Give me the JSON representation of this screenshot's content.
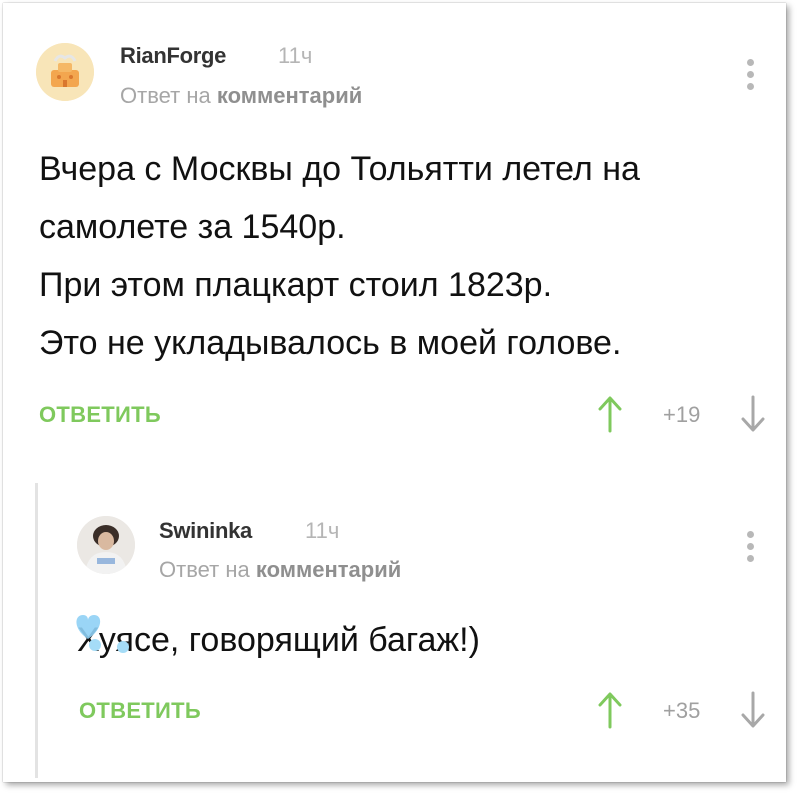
{
  "comments": [
    {
      "username": "RianForge",
      "time": "11ч",
      "reply_prefix": "Ответ на",
      "reply_target": "комментарий",
      "lines": [
        "Вчера с Москвы до Тольятти летел на",
        "самолете за 1540р.",
        "При этом плацкарт стоил 1823р.",
        "Это не укладывалось в моей голове."
      ],
      "reply_label": "ОТВЕТИТЬ",
      "rating": "+19"
    },
    {
      "username": "Swininka",
      "time": "11ч",
      "reply_prefix": "Ответ на",
      "reply_target": "комментарий",
      "lines": [
        "Хуясе, говорящий багаж!)"
      ],
      "reply_label": "ОТВЕТИТЬ",
      "rating": "+35"
    }
  ],
  "colors": {
    "accent_green": "#7fc95d",
    "text": "#111111",
    "muted": "#a6a6a6"
  },
  "icons": [
    "more-vertical-icon",
    "arrow-up-icon",
    "arrow-down-icon",
    "heart-icon"
  ]
}
